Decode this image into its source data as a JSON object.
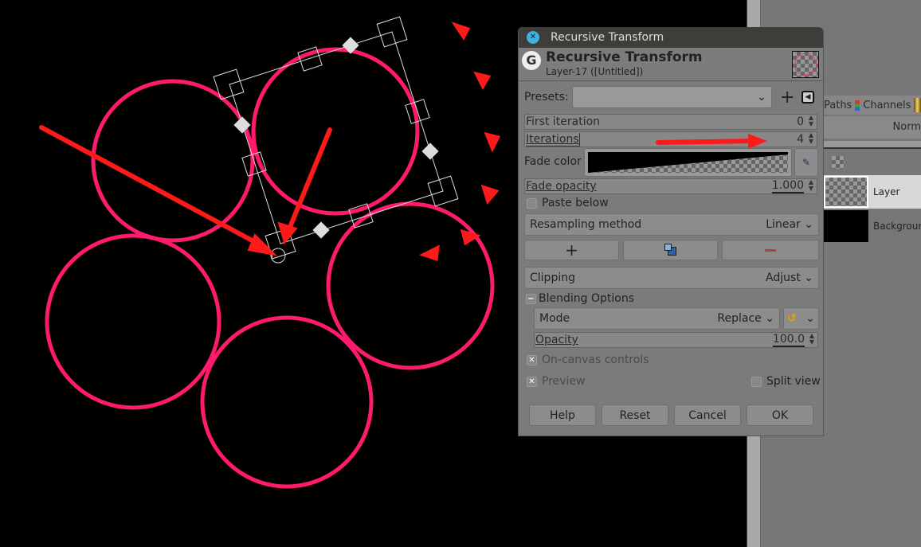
{
  "dialog": {
    "window_title": "Recursive Transform",
    "header_title": "Recursive Transform",
    "header_subtitle": "Layer-17 ([Untitled])",
    "presets_label": "Presets:",
    "presets_value": "",
    "first_iteration": {
      "label": "First iteration",
      "value": "0"
    },
    "iterations": {
      "label": "Iterations",
      "value": "4"
    },
    "fade_color_label": "Fade color",
    "fade_opacity": {
      "label": "Fade opacity",
      "value": "1.000"
    },
    "paste_below": {
      "label": "Paste below",
      "checked": false
    },
    "resampling": {
      "label": "Resampling method",
      "value": "Linear"
    },
    "clipping": {
      "label": "Clipping",
      "value": "Adjust"
    },
    "blending": {
      "label": "Blending Options",
      "mode_label": "Mode",
      "mode_value": "Replace",
      "opacity_label": "Opacity",
      "opacity_value": "100.0"
    },
    "on_canvas_controls": {
      "label": "On-canvas controls",
      "checked": true
    },
    "preview": {
      "label": "Preview",
      "checked": true
    },
    "split_view": {
      "label": "Split view",
      "checked": false
    },
    "buttons": {
      "help": "Help",
      "reset": "Reset",
      "cancel": "Cancel",
      "ok": "OK"
    }
  },
  "right_panel": {
    "tabs": [
      "Paths",
      "Channels"
    ],
    "mode_value": "Norm",
    "layers": [
      "Layer",
      "Background"
    ]
  },
  "colors": {
    "circle": "#ff1a6e",
    "annotation": "#ff1a1a",
    "dialog_bg": "#7b7b7b"
  }
}
